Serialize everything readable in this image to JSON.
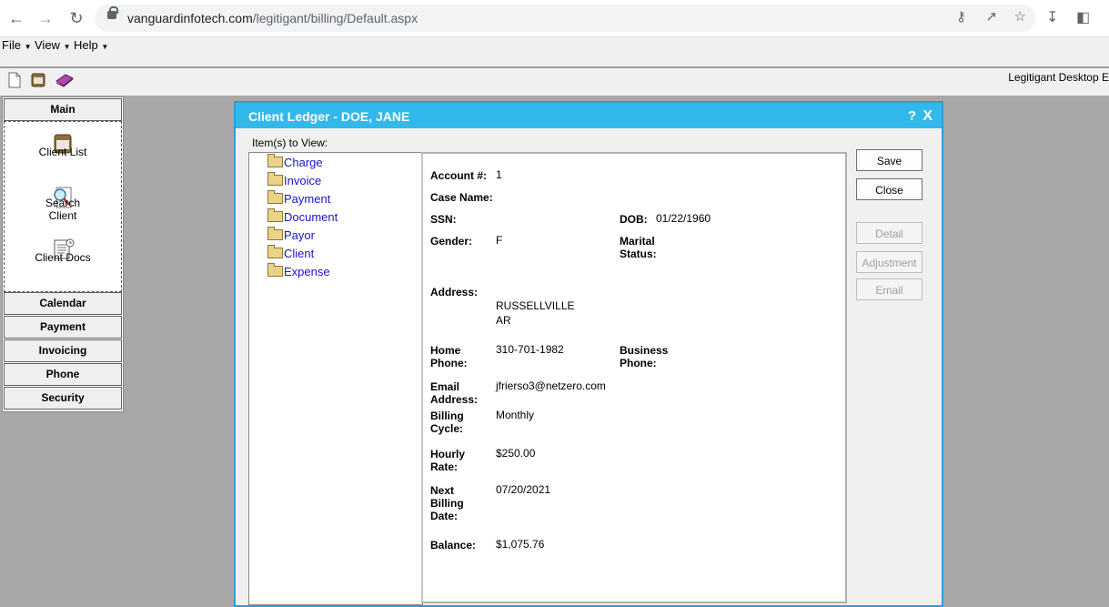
{
  "browser": {
    "url_host": "vanguardinfotech.com",
    "url_path": "/legitigant/billing/Default.aspx",
    "back_icon": "back-arrow-icon",
    "forward_icon": "forward-arrow-icon",
    "reload_icon": "reload-icon"
  },
  "menu": {
    "file": "File",
    "view": "View",
    "help": "Help"
  },
  "app_title": "Legitigant Desktop E",
  "sidebar": {
    "main": "Main",
    "tools": {
      "client_list": "Client List",
      "search_client_1": "Search",
      "search_client_2": "Client",
      "client_docs": "Client Docs"
    },
    "sections": [
      "Calendar",
      "Payment",
      "Invoicing",
      "Phone",
      "Security"
    ]
  },
  "dialog": {
    "title": "Client Ledger - DOE, JANE",
    "help": "?",
    "close": "X",
    "items_label": "Item(s) to View:",
    "tree": [
      "Charge",
      "Invoice",
      "Payment",
      "Document",
      "Payor",
      "Client",
      "Expense"
    ],
    "fields": {
      "account_label": "Account #:",
      "account_value": "1",
      "case_name_label": "Case Name:",
      "ssn_label": "SSN:",
      "dob_label": "DOB:",
      "dob_value": "01/22/1960",
      "gender_label": "Gender:",
      "gender_value": "F",
      "marital_label_1": "Marital",
      "marital_label_2": "Status:",
      "address_label": "Address:",
      "address_line1": "RUSSELLVILLE",
      "address_line2": "AR",
      "home_phone_label_1": "Home",
      "home_phone_label_2": "Phone:",
      "home_phone_value": "310-701-1982",
      "business_phone_label_1": "Business",
      "business_phone_label_2": "Phone:",
      "email_label_1": "Email",
      "email_label_2": "Address:",
      "email_value": "jfrierso3@netzero.com",
      "billing_cycle_label_1": "Billing",
      "billing_cycle_label_2": "Cycle:",
      "billing_cycle_value": "Monthly",
      "hourly_rate_label_1": "Hourly",
      "hourly_rate_label_2": "Rate:",
      "hourly_rate_value": "$250.00",
      "next_billing_label_1": "Next",
      "next_billing_label_2": "Billing",
      "next_billing_label_3": "Date:",
      "next_billing_value": "07/20/2021",
      "balance_label": "Balance:",
      "balance_value": "$1,075.76"
    },
    "buttons": {
      "save": "Save",
      "close": "Close",
      "detail": "Detail",
      "adjustment": "Adjustment",
      "email": "Email"
    }
  },
  "colors": {
    "title_bar": "#33b8ec",
    "tree_link": "#1a12c8",
    "desktop": "#a8a8a8"
  }
}
